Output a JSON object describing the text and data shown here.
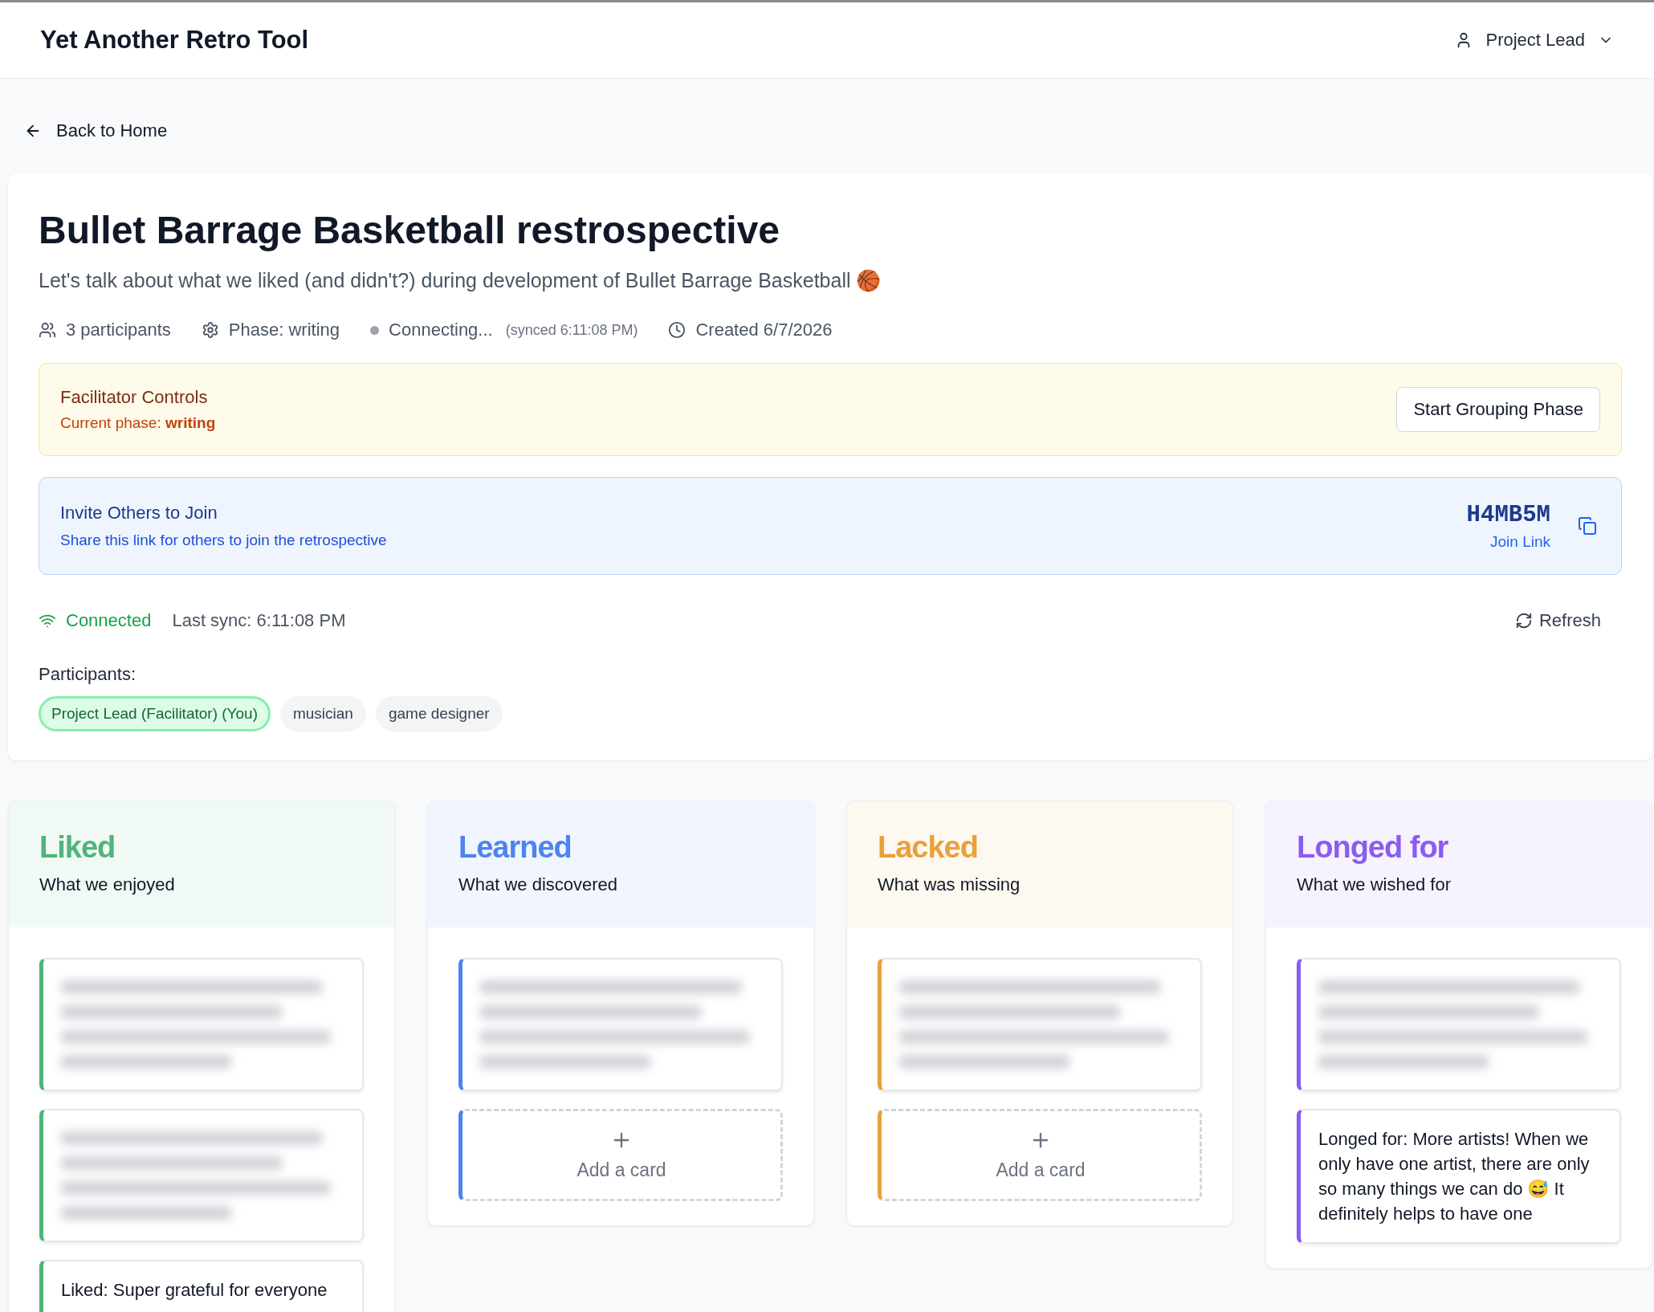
{
  "app": {
    "title": "Yet Another Retro Tool",
    "user": "Project Lead"
  },
  "back_link": "Back to Home",
  "retro": {
    "title": "Bullet Barrage Basketball restrospective",
    "description": "Let's talk about what we liked (and didn't?) during development of Bullet Barrage Basketball 🏀",
    "meta": [
      {
        "kind": "participants",
        "text": "3 participants"
      },
      {
        "kind": "phase",
        "text": "Phase: writing"
      },
      {
        "kind": "status",
        "text": "Connecting...",
        "note": "(synced 6:11:08 PM)"
      },
      {
        "kind": "created",
        "text": "Created 6/7/2026"
      }
    ]
  },
  "facilitator": {
    "title": "Facilitator Controls",
    "phase_label": "Current phase:",
    "phase": "writing",
    "button": "Start Grouping Phase"
  },
  "invite": {
    "title": "Invite Others to Join",
    "subtitle": "Share this link for others to join the retrospective",
    "code": "H4MB5M",
    "link": "Join Link"
  },
  "connection": {
    "status": "Connected",
    "connected": true,
    "last_sync": "Last sync: 6:11:08 PM",
    "refresh": "Refresh"
  },
  "participants": {
    "label": "Participants:",
    "items": [
      {
        "name": "Project Lead (Facilitator) (You)",
        "current": true
      },
      {
        "name": "musician",
        "current": false
      },
      {
        "name": "game designer",
        "current": false
      }
    ]
  },
  "columns": [
    {
      "title": "Liked",
      "subtitle": "What we enjoyed",
      "color": "#4fb57b",
      "cards": [
        {
          "kind": "blurred"
        },
        {
          "kind": "blurred"
        },
        {
          "kind": "text",
          "text": "Liked: Super grateful for everyone"
        }
      ]
    },
    {
      "title": "Learned",
      "subtitle": "What we discovered",
      "color": "#4d84ee",
      "cards": [
        {
          "kind": "blurred"
        }
      ],
      "add_card": "Add a card"
    },
    {
      "title": "Lacked",
      "subtitle": "What was missing",
      "color": "#eaa03a",
      "cards": [
        {
          "kind": "blurred"
        }
      ],
      "add_card": "Add a card"
    },
    {
      "title": "Longed for",
      "subtitle": "What we wished for",
      "color": "#8a5cf0",
      "cards": [
        {
          "kind": "blurred"
        },
        {
          "kind": "text",
          "text": "Longed for: More artists! When we only have one artist, there are only so many things we can do 😅 It definitely helps to have one"
        }
      ]
    }
  ]
}
